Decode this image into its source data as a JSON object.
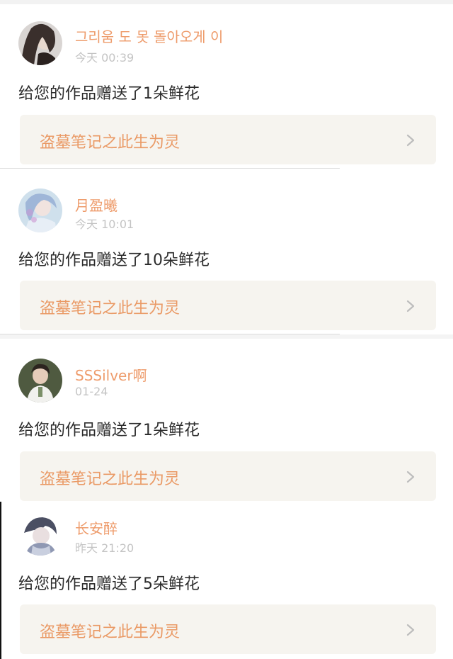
{
  "colors": {
    "accent": "#ee9c6c",
    "card_bg": "#f6f4ef",
    "timestamp": "#c4c4c4",
    "text": "#2b2b2b"
  },
  "notifications": [
    {
      "username": "그리움 도 못 돌아오게 이",
      "time": "今天 00:39",
      "message": "给您的作品赠送了1朵鲜花",
      "work_title": "盗墓笔记之此生为灵",
      "avatar": "avatar-girl-dark-hair",
      "icon": "chevron-right-icon"
    },
    {
      "username": "月盈曦",
      "time": "今天 10:01",
      "message": "给您的作品赠送了10朵鲜花",
      "work_title": "盗墓笔记之此生为灵",
      "avatar": "avatar-illustrated-girl",
      "icon": "chevron-right-icon"
    },
    {
      "username": "SSSilver啊",
      "time": "01-24",
      "message": "给您的作品赠送了1朵鲜花",
      "work_title": "盗墓笔记之此生为灵",
      "avatar": "avatar-person-photo",
      "icon": "chevron-right-icon"
    },
    {
      "username": "长安醉",
      "time": "昨天 21:20",
      "message": "给您的作品赠送了5朵鲜花",
      "work_title": "盗墓笔记之此生为灵",
      "avatar": "avatar-anime-character",
      "icon": "chevron-right-icon"
    }
  ]
}
